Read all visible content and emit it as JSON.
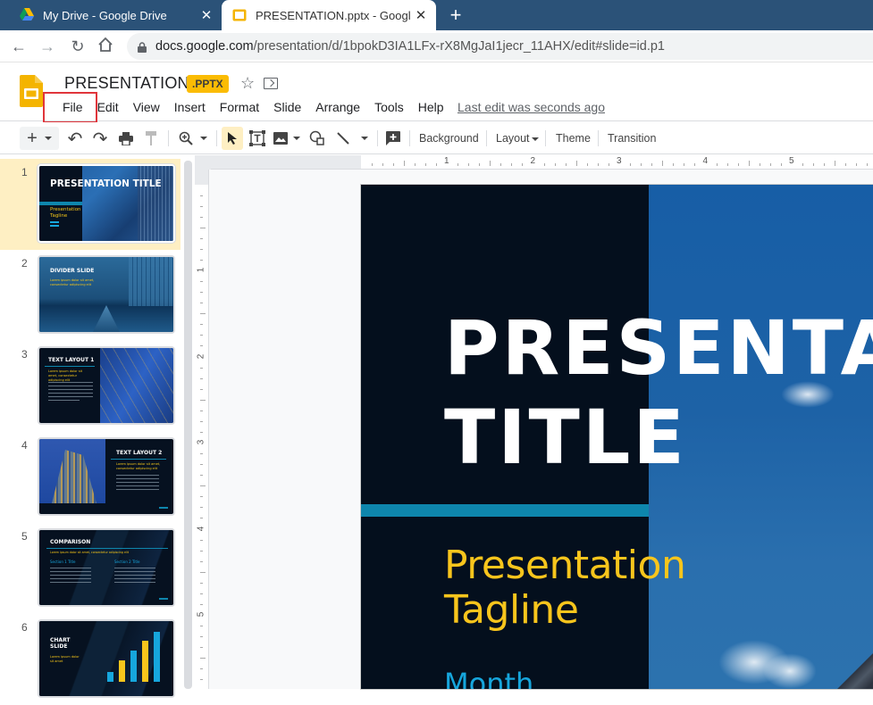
{
  "browser": {
    "tabs": [
      {
        "title": "My Drive - Google Drive",
        "icon": "google-drive-icon",
        "active": false
      },
      {
        "title": "PRESENTATION.pptx - Google Sli",
        "icon": "google-slides-icon",
        "active": true
      }
    ],
    "close_glyph": "✕",
    "new_tab_glyph": "+",
    "nav": {
      "back": "←",
      "forward": "→",
      "reload": "↻",
      "home": "⌂"
    },
    "url_host": "docs.google.com",
    "url_path": "/presentation/d/1bpokD3IA1LFx-rX8MgJaI1jecr_11AHX/edit#slide=id.p1"
  },
  "app": {
    "doc_title": "PRESENTATION",
    "file_badge": ".PPTX",
    "star_glyph": "☆",
    "menu": [
      "File",
      "Edit",
      "View",
      "Insert",
      "Format",
      "Slide",
      "Arrange",
      "Tools",
      "Help"
    ],
    "highlighted_menu": "File",
    "last_edit": "Last edit was seconds ago",
    "brand_color": "#fbbc04",
    "highlight_color": "#e0353b"
  },
  "toolbar": {
    "icons": [
      "new-slide",
      "undo",
      "redo",
      "print",
      "paint-format",
      "zoom",
      "select",
      "text-box",
      "image",
      "shape",
      "line",
      "comment"
    ],
    "glyphs": {
      "plus": "+",
      "undo": "↶",
      "redo": "↷",
      "print": "🖶",
      "paint": "⍑",
      "zoom": "⊕",
      "select": "➤",
      "textbox": "T",
      "shape": "◯",
      "line": "╲",
      "comment": "⊞"
    },
    "background_label": "Background",
    "layout_label": "Layout",
    "theme_label": "Theme",
    "transition_label": "Transition"
  },
  "ruler": {
    "horizontal_labels": [
      "1",
      "2",
      "3",
      "4",
      "5"
    ],
    "vertical_labels": [
      "1",
      "2",
      "3",
      "4",
      "5"
    ]
  },
  "filmstrip": {
    "selected_index": 0,
    "slides": [
      {
        "number": "1",
        "title": "PRESENTATION TITLE",
        "subtitle": "Presentation Tagline",
        "type": "title"
      },
      {
        "number": "2",
        "title": "DIVIDER SLIDE",
        "subtitle": "Lorem ipsum dolor sit amet, consectetur adipiscing elit",
        "type": "divider"
      },
      {
        "number": "3",
        "title": "TEXT LAYOUT 1",
        "subtitle": "Lorem ipsum dolor sit amet, consectetur adipiscing elit",
        "type": "text-left"
      },
      {
        "number": "4",
        "title": "TEXT LAYOUT 2",
        "subtitle": "Lorem ipsum dolor sit amet, consectetur adipiscing elit",
        "type": "text-right"
      },
      {
        "number": "5",
        "title": "COMPARISON",
        "subtitle": "Lorem ipsum dolor sit amet, consectetur adipiscing elit",
        "col1": "Section 1 Title",
        "col2": "Section 2 Title",
        "type": "comparison"
      },
      {
        "number": "6",
        "title": "CHART SLIDE",
        "subtitle": "Lorem ipsum dolor sit amet",
        "type": "chart",
        "bar_levels": [
          0.2,
          0.42,
          0.62,
          0.82,
          1.0
        ]
      }
    ]
  },
  "slide": {
    "title_line1": "PRESENTATION",
    "title_line2": "TITLE",
    "tagline_line1": "Presentation",
    "tagline_line2": "Tagline",
    "month": "Month",
    "colors": {
      "dark": "#040f1d",
      "accent": "#0e86ad",
      "tagline": "#f8c51c",
      "month": "#16a6dd",
      "sky": "#1a5fa3"
    }
  }
}
